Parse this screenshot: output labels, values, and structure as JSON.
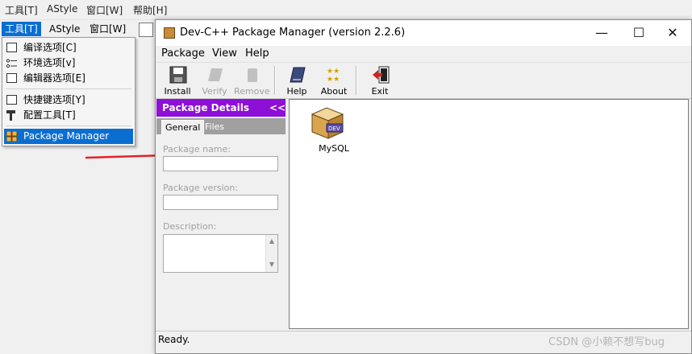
{
  "background_ide": {
    "menu": [
      "工具[T]",
      "AStyle",
      "窗口[W]",
      "帮助[H]"
    ]
  },
  "dropdown_menubar": {
    "items": [
      "工具[T]",
      "AStyle",
      "窗口[W]"
    ]
  },
  "dropdown": {
    "items": [
      {
        "label": "编译选项[C]",
        "icon": "compile-options-icon"
      },
      {
        "label": "环境选项[v]",
        "icon": "environment-options-icon"
      },
      {
        "label": "编辑器选项[E]",
        "icon": "editor-options-icon"
      },
      {
        "label": "快捷键选项[Y]",
        "icon": "shortcut-options-icon"
      },
      {
        "label": "配置工具[T]",
        "icon": "configure-tools-icon"
      },
      {
        "label": "Package Manager",
        "icon": "package-manager-icon"
      }
    ]
  },
  "window": {
    "title": "Dev-C++ Package Manager (version 2.2.6)",
    "controls": {
      "minimize": "—",
      "maximize": "☐",
      "close": "✕"
    },
    "menu": [
      "Package",
      "View",
      "Help"
    ],
    "toolbar": [
      {
        "label": "Install",
        "icon": "install-icon",
        "enabled": true
      },
      {
        "label": "Verify",
        "icon": "verify-icon",
        "enabled": false
      },
      {
        "label": "Remove",
        "icon": "remove-icon",
        "enabled": false
      },
      {
        "label": "Help",
        "icon": "help-book-icon",
        "enabled": true
      },
      {
        "label": "About",
        "icon": "about-stars-icon",
        "enabled": true
      },
      {
        "label": "Exit",
        "icon": "exit-icon",
        "enabled": true
      }
    ],
    "details": {
      "header": "Package Details",
      "collapse": "<<",
      "tabs": [
        "General",
        "Files"
      ],
      "fields": {
        "name_label": "Package name:",
        "name_value": "",
        "version_label": "Package version:",
        "version_value": "",
        "description_label": "Description:",
        "description_value": ""
      }
    },
    "packages": [
      {
        "name": "MySQL",
        "icon": "package-box-icon",
        "badge": "DEV"
      }
    ],
    "status": "Ready."
  },
  "watermark": "CSDN @小赖不想写bug"
}
